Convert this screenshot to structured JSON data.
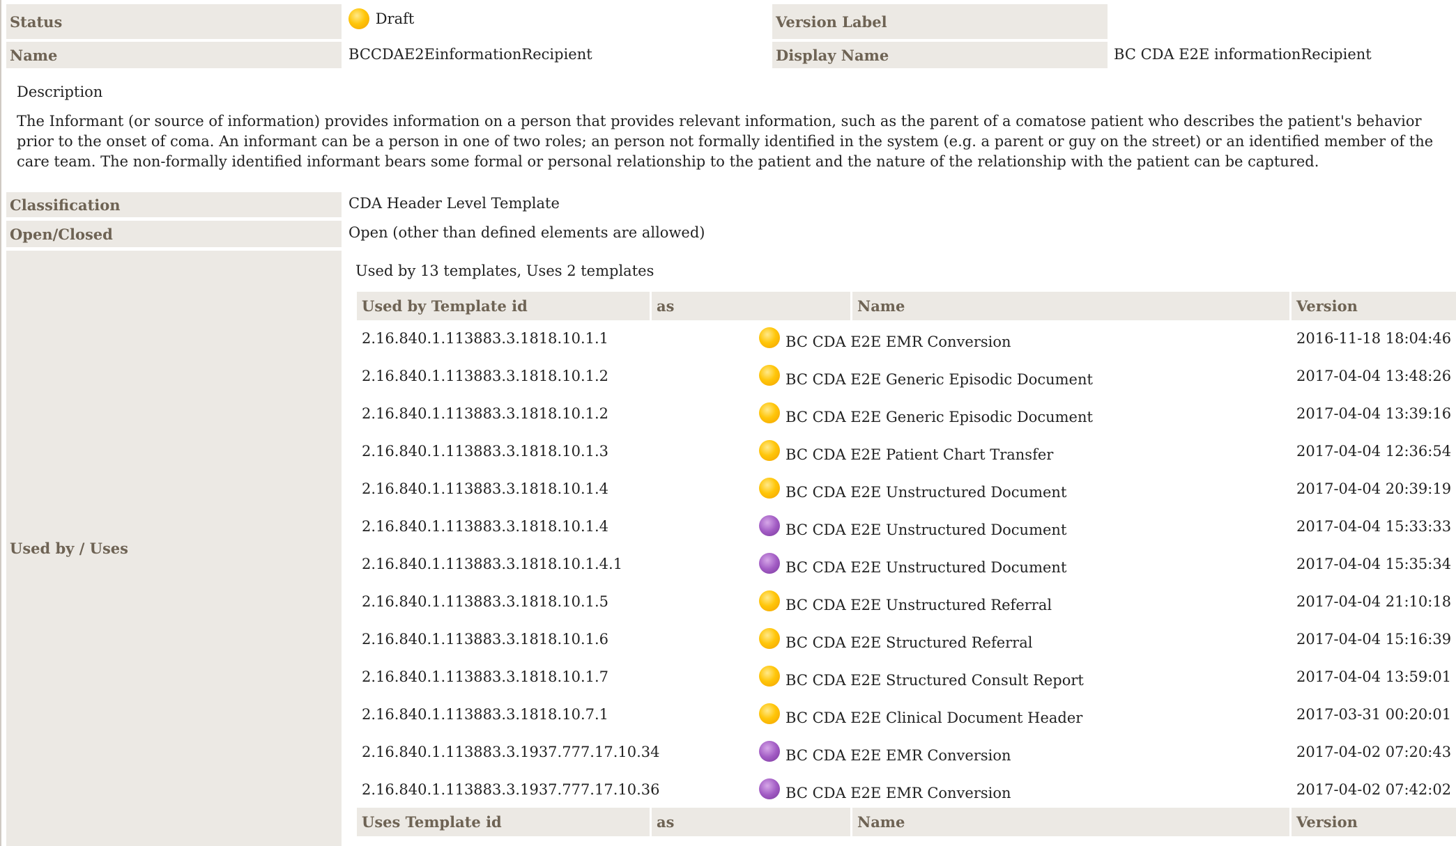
{
  "header": {
    "status_label": "Status",
    "status_value": "Draft",
    "version_label_label": "Version Label",
    "version_label_value": "",
    "name_label": "Name",
    "name_value": "BCCDAE2EinformationRecipient",
    "display_name_label": "Display Name",
    "display_name_value": "BC CDA E2E informationRecipient"
  },
  "description": {
    "label": "Description",
    "text": "The Informant (or source of information) provides information on a person that provides relevant information, such as the parent of a comatose patient who describes the patient's behavior prior to the onset of coma. An informant can be a person in one of two roles; an person not formally identified in the system (e.g. a parent or guy on the street) or an identified member of the care team. The non-formally identified informant bears some formal or personal relationship to the patient and the nature of the relationship with the patient can be captured."
  },
  "classification": {
    "label": "Classification",
    "value": "CDA Header Level Template"
  },
  "open_closed": {
    "label": "Open/Closed",
    "value": "Open (other than defined elements are allowed)"
  },
  "usage": {
    "label": "Used by / Uses",
    "summary": "Used by 13 templates, Uses 2 templates",
    "used_by_headers": {
      "template_id": "Used by Template id",
      "as": "as",
      "name": "Name",
      "version": "Version"
    },
    "uses_headers": {
      "template_id": "Uses Template id",
      "as": "as",
      "name": "Name",
      "version": "Version"
    },
    "status_colors": {
      "draft": "#ffc60a",
      "other": "#a25cc4"
    },
    "rows": [
      {
        "id": "2.16.840.1.113883.3.1818.10.1.1",
        "as": "",
        "status": "draft",
        "name": "BC CDA E2E EMR Conversion",
        "version": "2016-11-18 18:04:46"
      },
      {
        "id": "2.16.840.1.113883.3.1818.10.1.2",
        "as": "",
        "status": "draft",
        "name": "BC CDA E2E Generic Episodic Document",
        "version": "2017-04-04 13:48:26"
      },
      {
        "id": "2.16.840.1.113883.3.1818.10.1.2",
        "as": "",
        "status": "draft",
        "name": "BC CDA E2E Generic Episodic Document",
        "version": "2017-04-04 13:39:16"
      },
      {
        "id": "2.16.840.1.113883.3.1818.10.1.3",
        "as": "",
        "status": "draft",
        "name": "BC CDA E2E Patient Chart Transfer",
        "version": "2017-04-04 12:36:54"
      },
      {
        "id": "2.16.840.1.113883.3.1818.10.1.4",
        "as": "",
        "status": "draft",
        "name": "BC CDA E2E Unstructured Document",
        "version": "2017-04-04 20:39:19"
      },
      {
        "id": "2.16.840.1.113883.3.1818.10.1.4",
        "as": "",
        "status": "other",
        "name": "BC CDA E2E Unstructured Document",
        "version": "2017-04-04 15:33:33"
      },
      {
        "id": "2.16.840.1.113883.3.1818.10.1.4.1",
        "as": "",
        "status": "other",
        "name": "BC CDA E2E Unstructured Document",
        "version": "2017-04-04 15:35:34"
      },
      {
        "id": "2.16.840.1.113883.3.1818.10.1.5",
        "as": "",
        "status": "draft",
        "name": "BC CDA E2E Unstructured Referral",
        "version": "2017-04-04 21:10:18"
      },
      {
        "id": "2.16.840.1.113883.3.1818.10.1.6",
        "as": "",
        "status": "draft",
        "name": "BC CDA E2E Structured Referral",
        "version": "2017-04-04 15:16:39"
      },
      {
        "id": "2.16.840.1.113883.3.1818.10.1.7",
        "as": "",
        "status": "draft",
        "name": "BC CDA E2E Structured Consult Report",
        "version": "2017-04-04 13:59:01"
      },
      {
        "id": "2.16.840.1.113883.3.1818.10.7.1",
        "as": "",
        "status": "draft",
        "name": "BC CDA E2E Clinical Document Header",
        "version": "2017-03-31 00:20:01"
      },
      {
        "id": "2.16.840.1.113883.3.1937.777.17.10.34",
        "as": "",
        "status": "other",
        "name": "BC CDA E2E EMR Conversion",
        "version": "2017-04-02 07:20:43"
      },
      {
        "id": "2.16.840.1.113883.3.1937.777.17.10.36",
        "as": "",
        "status": "other",
        "name": "BC CDA E2E EMR Conversion",
        "version": "2017-04-02 07:42:02"
      }
    ]
  }
}
